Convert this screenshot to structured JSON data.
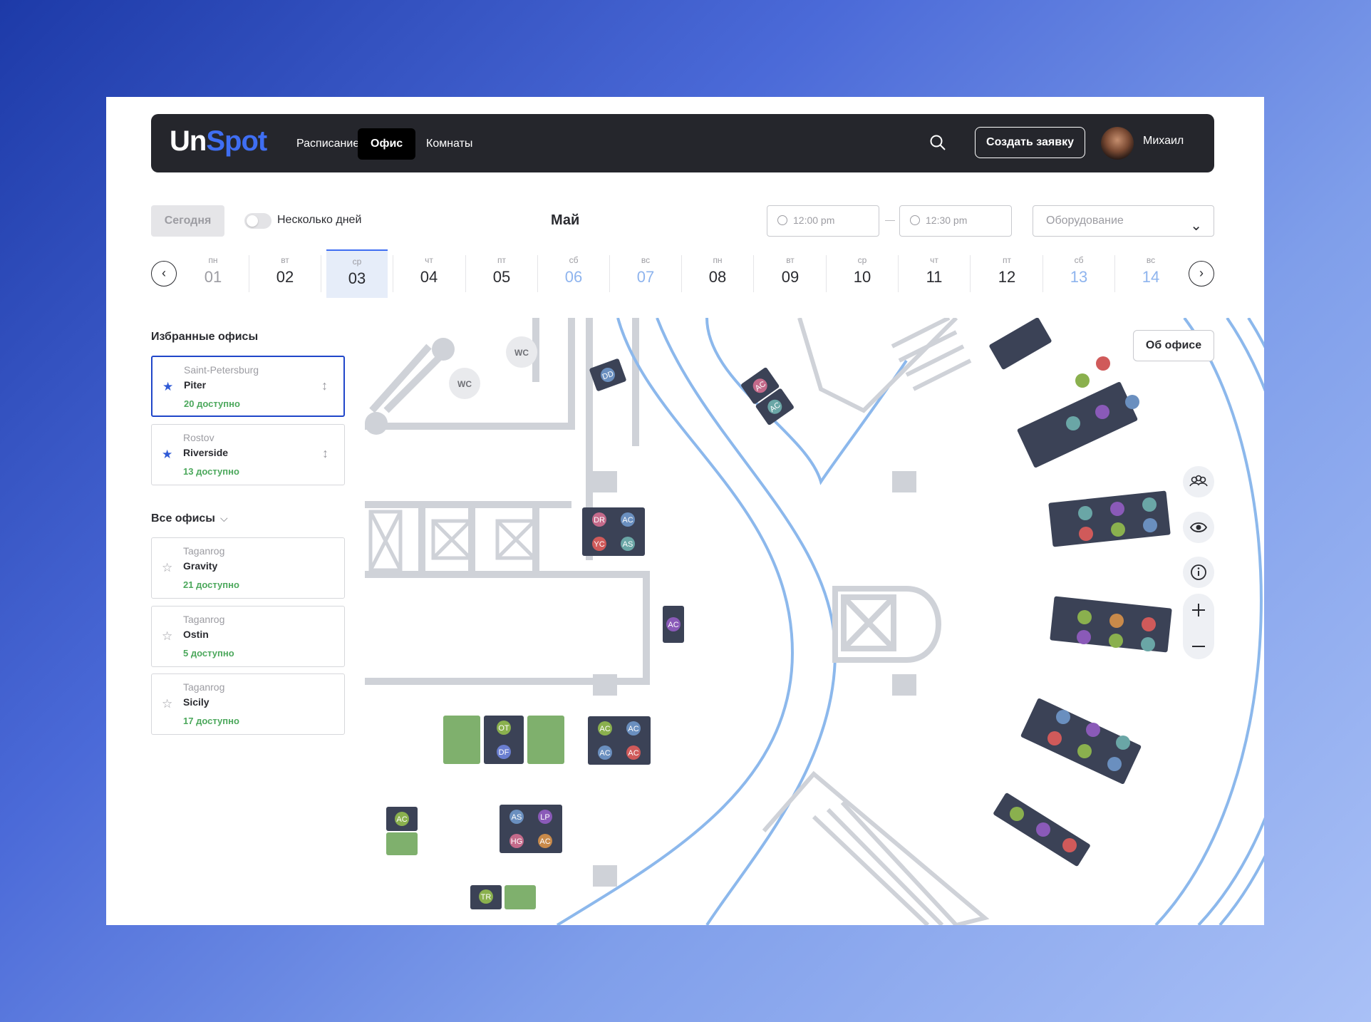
{
  "header": {
    "logo_un": "Un",
    "logo_spot": "Spot",
    "nav": [
      "Расписание",
      "Офис",
      "Комнаты"
    ],
    "active_nav": "Офис",
    "create_button": "Создать заявку",
    "user_name": "Михаил"
  },
  "controls": {
    "today": "Сегодня",
    "multi_days_label": "Несколько дней",
    "multi_days_enabled": false,
    "month": "Май",
    "time_from": "12:00 pm",
    "time_to": "12:30 pm",
    "time_separator": "—",
    "equipment_placeholder": "Оборудование"
  },
  "dates": [
    {
      "dow": "пн",
      "num": "01",
      "state": "past"
    },
    {
      "dow": "вт",
      "num": "02",
      "state": "normal"
    },
    {
      "dow": "ср",
      "num": "03",
      "state": "selected"
    },
    {
      "dow": "чт",
      "num": "04",
      "state": "normal"
    },
    {
      "dow": "пт",
      "num": "05",
      "state": "normal"
    },
    {
      "dow": "сб",
      "num": "06",
      "state": "weekend"
    },
    {
      "dow": "вс",
      "num": "07",
      "state": "weekend"
    },
    {
      "dow": "пн",
      "num": "08",
      "state": "normal"
    },
    {
      "dow": "вт",
      "num": "09",
      "state": "normal"
    },
    {
      "dow": "ср",
      "num": "10",
      "state": "normal"
    },
    {
      "dow": "чт",
      "num": "11",
      "state": "normal"
    },
    {
      "dow": "пт",
      "num": "12",
      "state": "normal"
    },
    {
      "dow": "сб",
      "num": "13",
      "state": "weekend"
    },
    {
      "dow": "вс",
      "num": "14",
      "state": "weekend"
    }
  ],
  "sidebar": {
    "favorites_title": "Избранные офисы",
    "favorites": [
      {
        "city": "Saint-Petersburg",
        "name": "Piter",
        "available": "20 доступно",
        "selected": true
      },
      {
        "city": "Rostov",
        "name": "Riverside",
        "available": "13 доступно",
        "selected": false
      }
    ],
    "all_title": "Все офисы",
    "all": [
      {
        "city": "Taganrog",
        "name": "Gravity",
        "available": "21 доступно"
      },
      {
        "city": "Taganrog",
        "name": "Ostin",
        "available": "5 доступно"
      },
      {
        "city": "Taganrog",
        "name": "Sicily",
        "available": "17 доступно"
      }
    ]
  },
  "map": {
    "about_button": "Об офисе",
    "wc_label": "WC",
    "colors": {
      "busy": "#3b4256",
      "free": "#7fb06d",
      "wall": "#cfd2d8",
      "glass": "#8cb8ec"
    },
    "desk_groups": [
      {
        "name": "desk-group-dd",
        "seats": [
          {
            "initials": "DD",
            "color": "#6a8fbf"
          }
        ]
      },
      {
        "name": "desk-group-ac-left",
        "seats": [
          {
            "initials": "AC",
            "color": "#c46a8a"
          },
          {
            "initials": "AC",
            "color": "#6aa6a6"
          }
        ]
      },
      {
        "name": "desk-group-dr",
        "seats": [
          {
            "initials": "DR",
            "color": "#c46a8a"
          },
          {
            "initials": "AC",
            "color": "#6a8fbf"
          },
          {
            "initials": "YC",
            "color": "#d05a5a"
          },
          {
            "initials": "AS",
            "color": "#6aa6a6"
          }
        ]
      },
      {
        "name": "desk-single-ac",
        "seats": [
          {
            "initials": "AC",
            "color": "#8a5ab8"
          }
        ]
      },
      {
        "name": "desk-group-ot",
        "seats": [
          {
            "initials": "OT",
            "color": "#8ab04e"
          },
          {
            "initials": "DF",
            "color": "#6a7ed0"
          }
        ]
      },
      {
        "name": "desk-group-ac-mid",
        "seats": [
          {
            "initials": "AC",
            "color": "#8ab04e"
          },
          {
            "initials": "AC",
            "color": "#6a8fbf"
          },
          {
            "initials": "AC",
            "color": "#6a8fbf"
          },
          {
            "initials": "AC",
            "color": "#d05a5a"
          }
        ]
      },
      {
        "name": "desk-group-ac-low",
        "seats": [
          {
            "initials": "AC",
            "color": "#8ab04e"
          }
        ]
      },
      {
        "name": "desk-group-as",
        "seats": [
          {
            "initials": "AS",
            "color": "#6a8fbf"
          },
          {
            "initials": "LP",
            "color": "#8a5ab8"
          },
          {
            "initials": "HG",
            "color": "#c46a8a"
          },
          {
            "initials": "AC",
            "color": "#c98a4a"
          }
        ]
      },
      {
        "name": "desk-group-tr",
        "seats": [
          {
            "initials": "TR",
            "color": "#8ab04e"
          }
        ]
      }
    ]
  }
}
